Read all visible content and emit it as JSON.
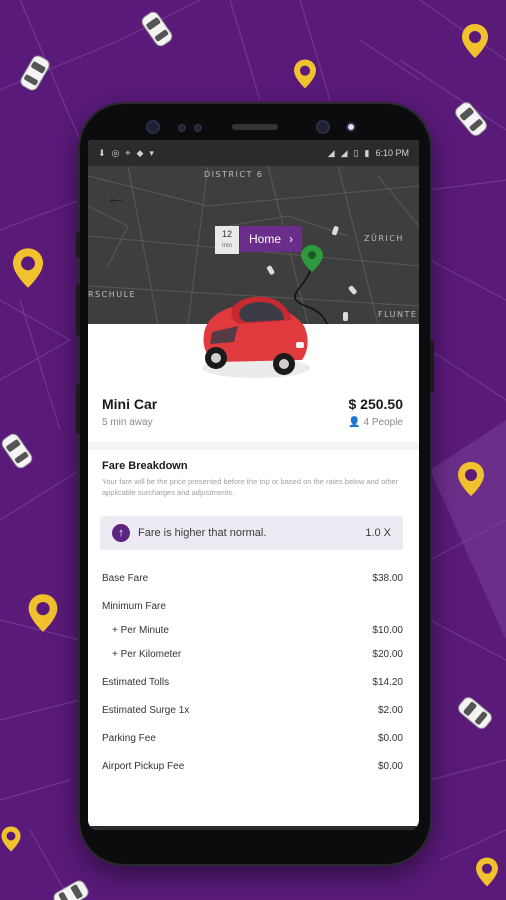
{
  "status_bar": {
    "time": "6:10 PM"
  },
  "map": {
    "labels": [
      "DISTRICT 6",
      "ZÜRICH",
      "RSCHULE",
      "FLUNTE"
    ],
    "eta_value": "12",
    "eta_unit": "min",
    "destination_label": "Home"
  },
  "ride": {
    "name": "Mini Car",
    "eta_text": "5 min away",
    "price": "$ 250.50",
    "capacity": "4 People"
  },
  "fare_breakdown": {
    "title": "Fare Breakdown",
    "note": "Your fare will be the price presented before the trip or based on the rates below and other applicable surcharges and adjustments.",
    "alert_text": "Fare is higher that normal.",
    "alert_multiplier": "1.0 X",
    "rows": [
      {
        "label": "Base Fare",
        "value": "$38.00"
      },
      {
        "label": "Minimum Fare",
        "value": ""
      },
      {
        "label": "+ Per Minute",
        "value": "$10.00"
      },
      {
        "label": "+ Per Kilometer",
        "value": "$20.00"
      },
      {
        "label": "Estimated Tolls",
        "value": "$14.20"
      },
      {
        "label": "Estimated Surge 1x",
        "value": "$2.00"
      },
      {
        "label": "Parking Fee",
        "value": "$0.00"
      },
      {
        "label": "Airport Pickup Fee",
        "value": "$0.00"
      }
    ]
  },
  "colors": {
    "background_purple": "#5a1a7a",
    "accent_purple": "#5e2483",
    "pin_yellow": "#f2c12e",
    "car_red": "#e03a3e"
  }
}
